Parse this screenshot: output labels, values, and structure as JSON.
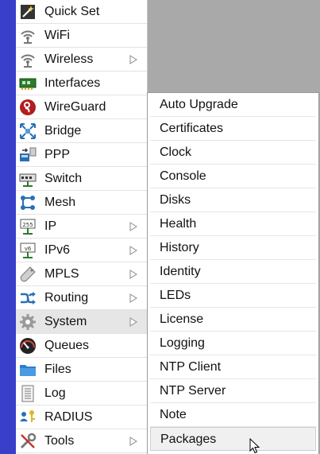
{
  "menu": {
    "items": [
      {
        "label": "Quick Set",
        "icon": "wand-icon",
        "has_submenu": false
      },
      {
        "label": "WiFi",
        "icon": "wifi-icon",
        "has_submenu": false
      },
      {
        "label": "Wireless",
        "icon": "wireless-icon",
        "has_submenu": true
      },
      {
        "label": "Interfaces",
        "icon": "interfaces-icon",
        "has_submenu": false
      },
      {
        "label": "WireGuard",
        "icon": "wireguard-icon",
        "has_submenu": false
      },
      {
        "label": "Bridge",
        "icon": "bridge-icon",
        "has_submenu": false
      },
      {
        "label": "PPP",
        "icon": "ppp-icon",
        "has_submenu": false
      },
      {
        "label": "Switch",
        "icon": "switch-icon",
        "has_submenu": false
      },
      {
        "label": "Mesh",
        "icon": "mesh-icon",
        "has_submenu": false
      },
      {
        "label": "IP",
        "icon": "ip-icon",
        "has_submenu": true
      },
      {
        "label": "IPv6",
        "icon": "ipv6-icon",
        "has_submenu": true
      },
      {
        "label": "MPLS",
        "icon": "mpls-icon",
        "has_submenu": true
      },
      {
        "label": "Routing",
        "icon": "routing-icon",
        "has_submenu": true
      },
      {
        "label": "System",
        "icon": "gear-icon",
        "has_submenu": true
      },
      {
        "label": "Queues",
        "icon": "queues-icon",
        "has_submenu": false
      },
      {
        "label": "Files",
        "icon": "folder-icon",
        "has_submenu": false
      },
      {
        "label": "Log",
        "icon": "log-icon",
        "has_submenu": false
      },
      {
        "label": "RADIUS",
        "icon": "radius-icon",
        "has_submenu": false
      },
      {
        "label": "Tools",
        "icon": "tools-icon",
        "has_submenu": true
      }
    ],
    "selected": "System"
  },
  "submenu": {
    "parent": "System",
    "items": [
      {
        "label": "Auto Upgrade"
      },
      {
        "label": "Certificates"
      },
      {
        "label": "Clock"
      },
      {
        "label": "Console"
      },
      {
        "label": "Disks"
      },
      {
        "label": "Health"
      },
      {
        "label": "History"
      },
      {
        "label": "Identity"
      },
      {
        "label": "LEDs"
      },
      {
        "label": "License"
      },
      {
        "label": "Logging"
      },
      {
        "label": "NTP Client"
      },
      {
        "label": "NTP Server"
      },
      {
        "label": "Note"
      },
      {
        "label": "Packages"
      }
    ],
    "hovered": "Packages"
  },
  "colors": {
    "left_bar": "#3a3fc9",
    "background": "#a9a9a9",
    "selected_row": "#e6e6e6"
  }
}
